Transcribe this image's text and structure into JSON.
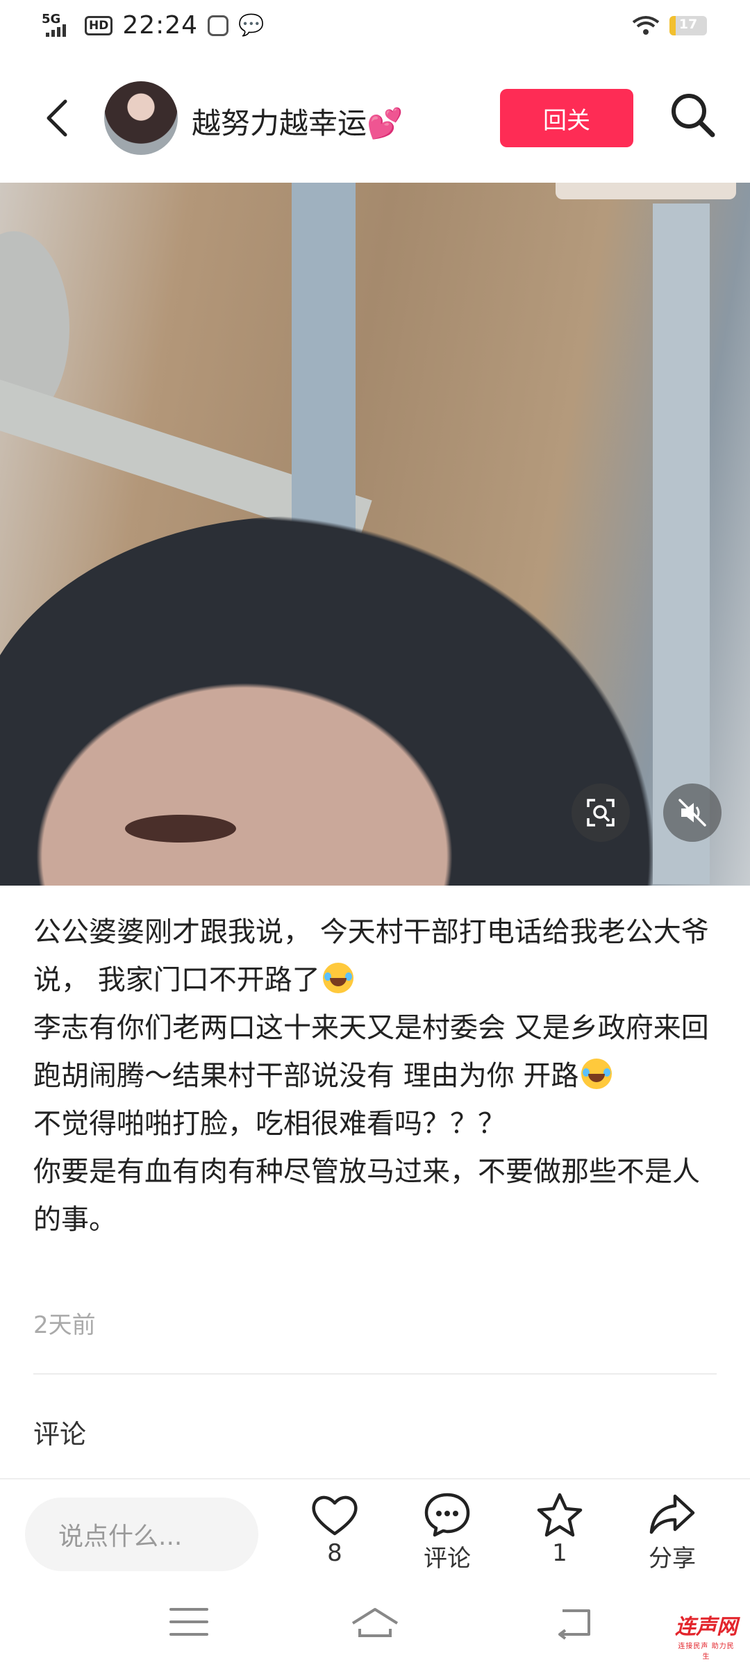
{
  "status_bar": {
    "network": "5G",
    "hd": "HD",
    "time": "22:24",
    "battery": "17",
    "battery_level": 0.17
  },
  "header": {
    "username": "越努力越幸运💕",
    "follow_label": "回关"
  },
  "post": {
    "lines": [
      "公公婆婆刚才跟我说， 今天村干部打电话给我老公大爷说， 我家门口不开路了",
      "李志有你们老两口这十来天又是村委会 又是乡政府来回跑胡闹腾～结果村干部说没有 理由为你 开路",
      "不觉得啪啪打脸，吃相很难看吗？？？",
      "你要是有血有肉有种尽管放马过来，不要做那些不是人的事。"
    ],
    "timestamp": "2天前"
  },
  "comments": {
    "title": "评论"
  },
  "bottom_bar": {
    "input_placeholder": "说点什么...",
    "like_count": "8",
    "comment_label": "评论",
    "favorite_count": "1",
    "share_label": "分享"
  },
  "watermark": {
    "text": "连声网",
    "sub": "连接民声 助力民生"
  },
  "colors": {
    "accent": "#fe2c55",
    "watermark": "#e3252c"
  },
  "icons": [
    "back-icon",
    "search-icon",
    "scan-icon",
    "mute-icon",
    "heart-icon",
    "comment-icon",
    "star-icon",
    "share-icon",
    "menu-icon",
    "home-icon",
    "back-nav-icon"
  ]
}
